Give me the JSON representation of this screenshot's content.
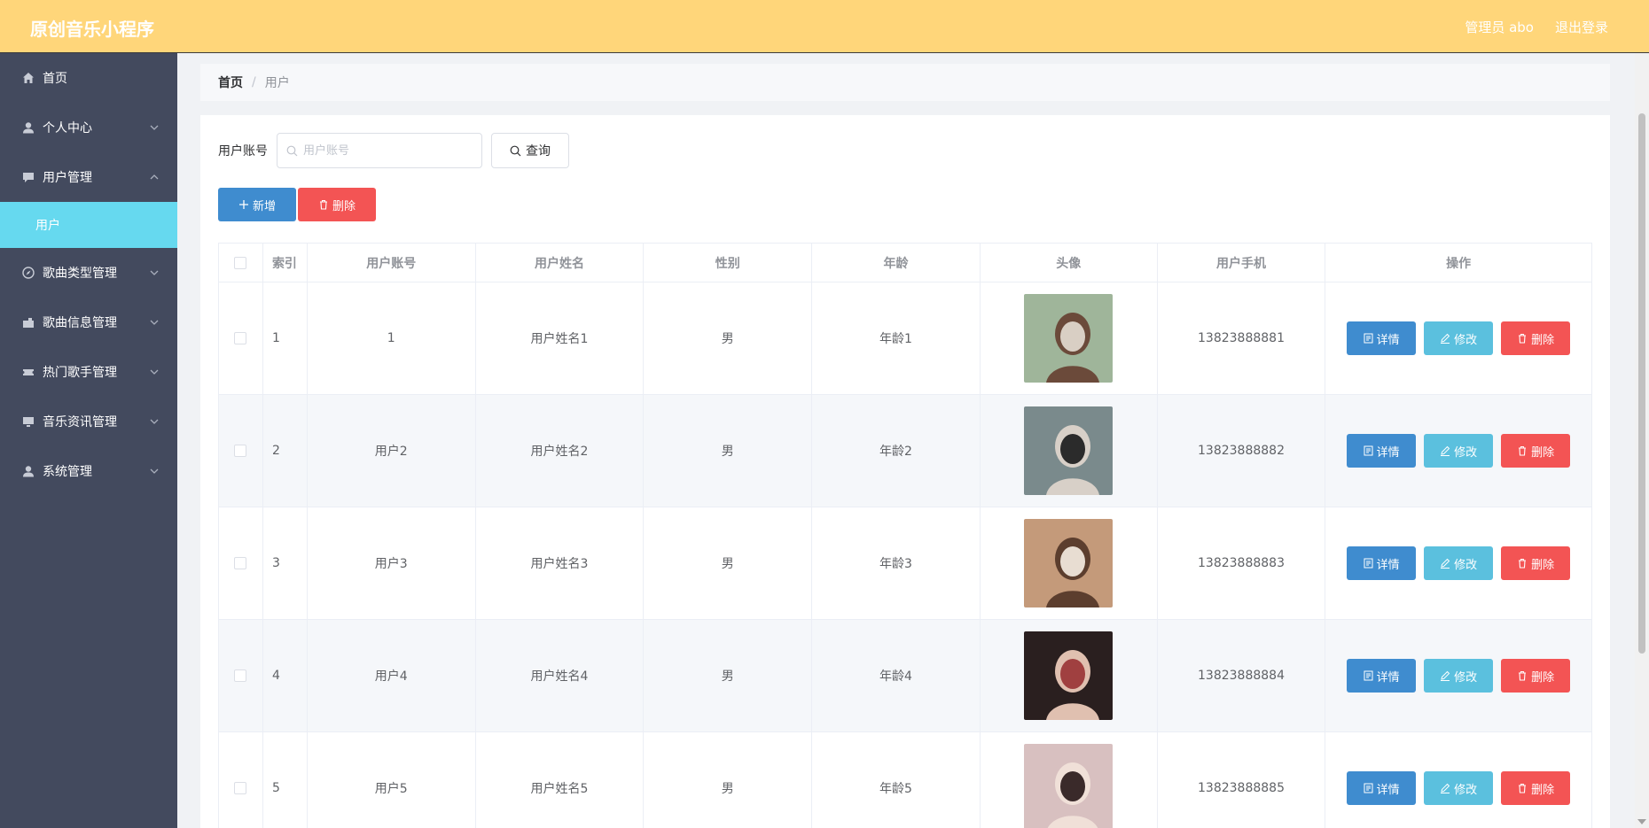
{
  "app": {
    "title": "原创音乐小程序",
    "admin_label": "管理员 abo",
    "logout_label": "退出登录"
  },
  "sidebar": {
    "items": [
      {
        "label": "首页",
        "icon": "home-icon",
        "expandable": false
      },
      {
        "label": "个人中心",
        "icon": "person-icon",
        "expandable": true
      },
      {
        "label": "用户管理",
        "icon": "chat-icon",
        "expandable": true,
        "expanded": true,
        "children": [
          {
            "label": "用户"
          }
        ]
      },
      {
        "label": "歌曲类型管理",
        "icon": "compass-icon",
        "expandable": true
      },
      {
        "label": "歌曲信息管理",
        "icon": "briefcase-icon",
        "expandable": true
      },
      {
        "label": "热门歌手管理",
        "icon": "ticket-icon",
        "expandable": true
      },
      {
        "label": "音乐资讯管理",
        "icon": "monitor-icon",
        "expandable": true
      },
      {
        "label": "系统管理",
        "icon": "person-icon",
        "expandable": true
      }
    ]
  },
  "breadcrumb": {
    "home": "首页",
    "separator": "/",
    "current": "用户"
  },
  "search": {
    "label": "用户账号",
    "placeholder": "用户账号",
    "value": "",
    "query_label": "查询"
  },
  "actions": {
    "add_label": "新增",
    "delete_label": "删除"
  },
  "table": {
    "headers": [
      "索引",
      "用户账号",
      "用户姓名",
      "性别",
      "年龄",
      "头像",
      "用户手机",
      "操作"
    ],
    "op_labels": {
      "detail": "详情",
      "edit": "修改",
      "delete": "删除"
    },
    "rows": [
      {
        "index": "1",
        "account": "1",
        "name": "用户姓名1",
        "gender": "男",
        "age": "年龄1",
        "phone": "13823888881"
      },
      {
        "index": "2",
        "account": "用户2",
        "name": "用户姓名2",
        "gender": "男",
        "age": "年龄2",
        "phone": "13823888882"
      },
      {
        "index": "3",
        "account": "用户3",
        "name": "用户姓名3",
        "gender": "男",
        "age": "年龄3",
        "phone": "13823888883"
      },
      {
        "index": "4",
        "account": "用户4",
        "name": "用户姓名4",
        "gender": "男",
        "age": "年龄4",
        "phone": "13823888884"
      },
      {
        "index": "5",
        "account": "用户5",
        "name": "用户姓名5",
        "gender": "男",
        "age": "年龄5",
        "phone": "13823888885"
      }
    ]
  },
  "colors": {
    "header_bg": "#ffd67a",
    "sidebar_bg": "#434a5e",
    "submenu_active": "#66d9ef",
    "primary": "#3f8ccf",
    "info": "#5bc0de",
    "danger": "#f35454"
  }
}
